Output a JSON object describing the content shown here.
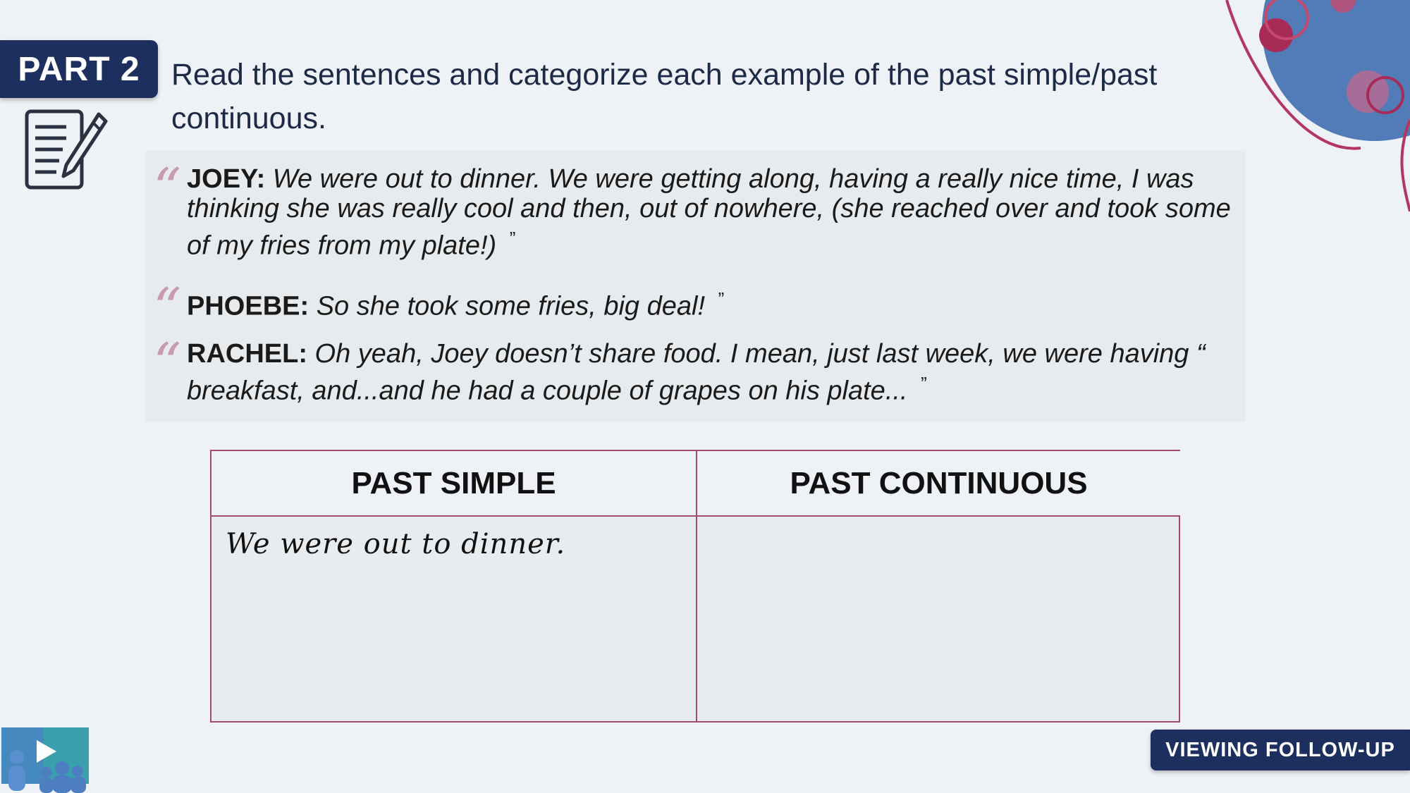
{
  "badge": {
    "label": "PART 2"
  },
  "instruction": "Read the sentences and categorize each example of the past simple/past continuous.",
  "quotes": [
    {
      "speaker": "JOEY:",
      "text": "We were out to dinner. We were getting along, having a really nice time, I was thinking she was really cool and then, out of nowhere, (she reached over and took some of my fries from my plate!)",
      "open_mark": "“",
      "close_mark": "”"
    },
    {
      "speaker": "PHOEBE:",
      "text": "So she took some fries, big deal!",
      "open_mark": "“",
      "close_mark": "”"
    },
    {
      "speaker": "RACHEL:",
      "text": "Oh yeah, Joey doesn’t share food. I mean, just last week, we were having “ breakfast, and...and he had a couple of grapes on his plate...",
      "open_mark": "“",
      "close_mark": "”"
    }
  ],
  "table": {
    "headers": [
      "PAST SIMPLE",
      "PAST CONTINUOUS"
    ],
    "cells": {
      "past_simple": "We were out to dinner.",
      "past_continuous": ""
    }
  },
  "footer_button": {
    "label": "VIEWING FOLLOW-UP"
  },
  "icons": {
    "notes": "document-pencil-icon",
    "video": "video-group-icon",
    "decoration": "abstract-circles-decoration"
  },
  "colors": {
    "navy": "#1c2f5e",
    "accent_pink": "#a44a70",
    "quote_mark": "#c99aab",
    "blob_blue": "#3f6fb0"
  }
}
